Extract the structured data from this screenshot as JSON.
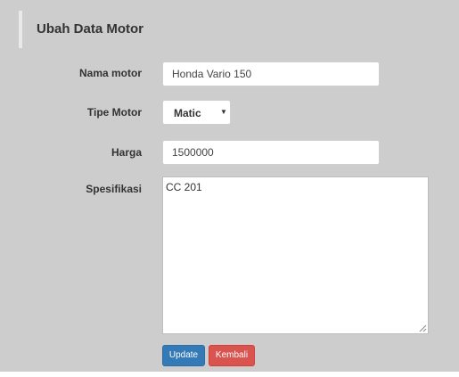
{
  "form": {
    "title": "Ubah Data Motor",
    "nama_motor": {
      "label": "Nama motor",
      "value": "Honda Vario 150"
    },
    "tipe_motor": {
      "label": "Tipe Motor",
      "selected": "Matic",
      "arrow": "▼"
    },
    "harga": {
      "label": "Harga",
      "value": "1500000"
    },
    "spesifikasi": {
      "label": "Spesifikasi",
      "value": "CC 201"
    },
    "buttons": {
      "update": "Update",
      "kembali": "Kembali"
    }
  },
  "colors": {
    "background": "#cdcdcd",
    "primary": "#337ab7",
    "danger": "#d9534f"
  },
  "icons": {
    "select_arrow": "chevron-down-icon",
    "resize": "resize-grip-icon"
  }
}
